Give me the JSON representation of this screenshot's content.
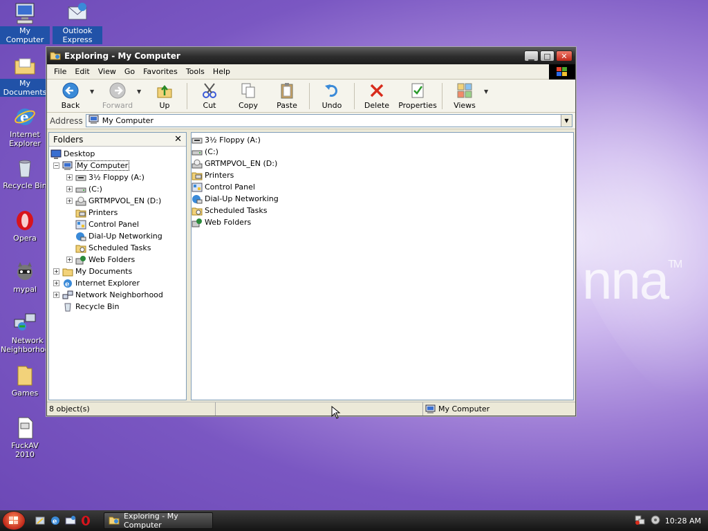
{
  "desktop": {
    "icons": [
      {
        "label": "My Computer",
        "icon": "computer-icon"
      },
      {
        "label": "Outlook Express",
        "icon": "outlook-express-icon"
      },
      {
        "label": "My Documents",
        "icon": "folder-documents-icon"
      },
      {
        "label": "Internet Explorer",
        "icon": "internet-explorer-icon"
      },
      {
        "label": "Recycle Bin",
        "icon": "recycle-bin-icon"
      },
      {
        "label": "Opera",
        "icon": "opera-icon"
      },
      {
        "label": "mypal",
        "icon": "mypal-icon"
      },
      {
        "label": "Network Neighborhood",
        "icon": "network-icon"
      },
      {
        "label": "Games",
        "icon": "folder-icon"
      },
      {
        "label": "FuckAV 2010",
        "icon": "file-icon"
      }
    ],
    "brand": "nna"
  },
  "window": {
    "title": "Exploring - My Computer",
    "menu": [
      "File",
      "Edit",
      "View",
      "Go",
      "Favorites",
      "Tools",
      "Help"
    ],
    "toolbar": {
      "back": "Back",
      "forward": "Forward",
      "up": "Up",
      "cut": "Cut",
      "copy": "Copy",
      "paste": "Paste",
      "undo": "Undo",
      "delete": "Delete",
      "properties": "Properties",
      "views": "Views"
    },
    "address": {
      "label": "Address",
      "value": "My Computer"
    },
    "folders_pane": {
      "header": "Folders",
      "tree": {
        "desktop": "Desktop",
        "my_computer": "My Computer",
        "children": [
          "3½ Floppy (A:)",
          "(C:)",
          "GRTMPVOL_EN (D:)",
          "Printers",
          "Control Panel",
          "Dial-Up Networking",
          "Scheduled Tasks",
          "Web Folders"
        ],
        "siblings": [
          "My Documents",
          "Internet Explorer",
          "Network Neighborhood",
          "Recycle Bin"
        ]
      }
    },
    "content_items": [
      "3½ Floppy (A:)",
      "(C:)",
      "GRTMPVOL_EN (D:)",
      "Printers",
      "Control Panel",
      "Dial-Up Networking",
      "Scheduled Tasks",
      "Web Folders"
    ],
    "status": {
      "count": "8 object(s)",
      "location": "My Computer"
    }
  },
  "taskbar": {
    "task_label": "Exploring - My Computer",
    "clock": "10:28 AM"
  },
  "colors": {
    "accent": "#2152a8",
    "titlebar": "#2f2f2f"
  }
}
